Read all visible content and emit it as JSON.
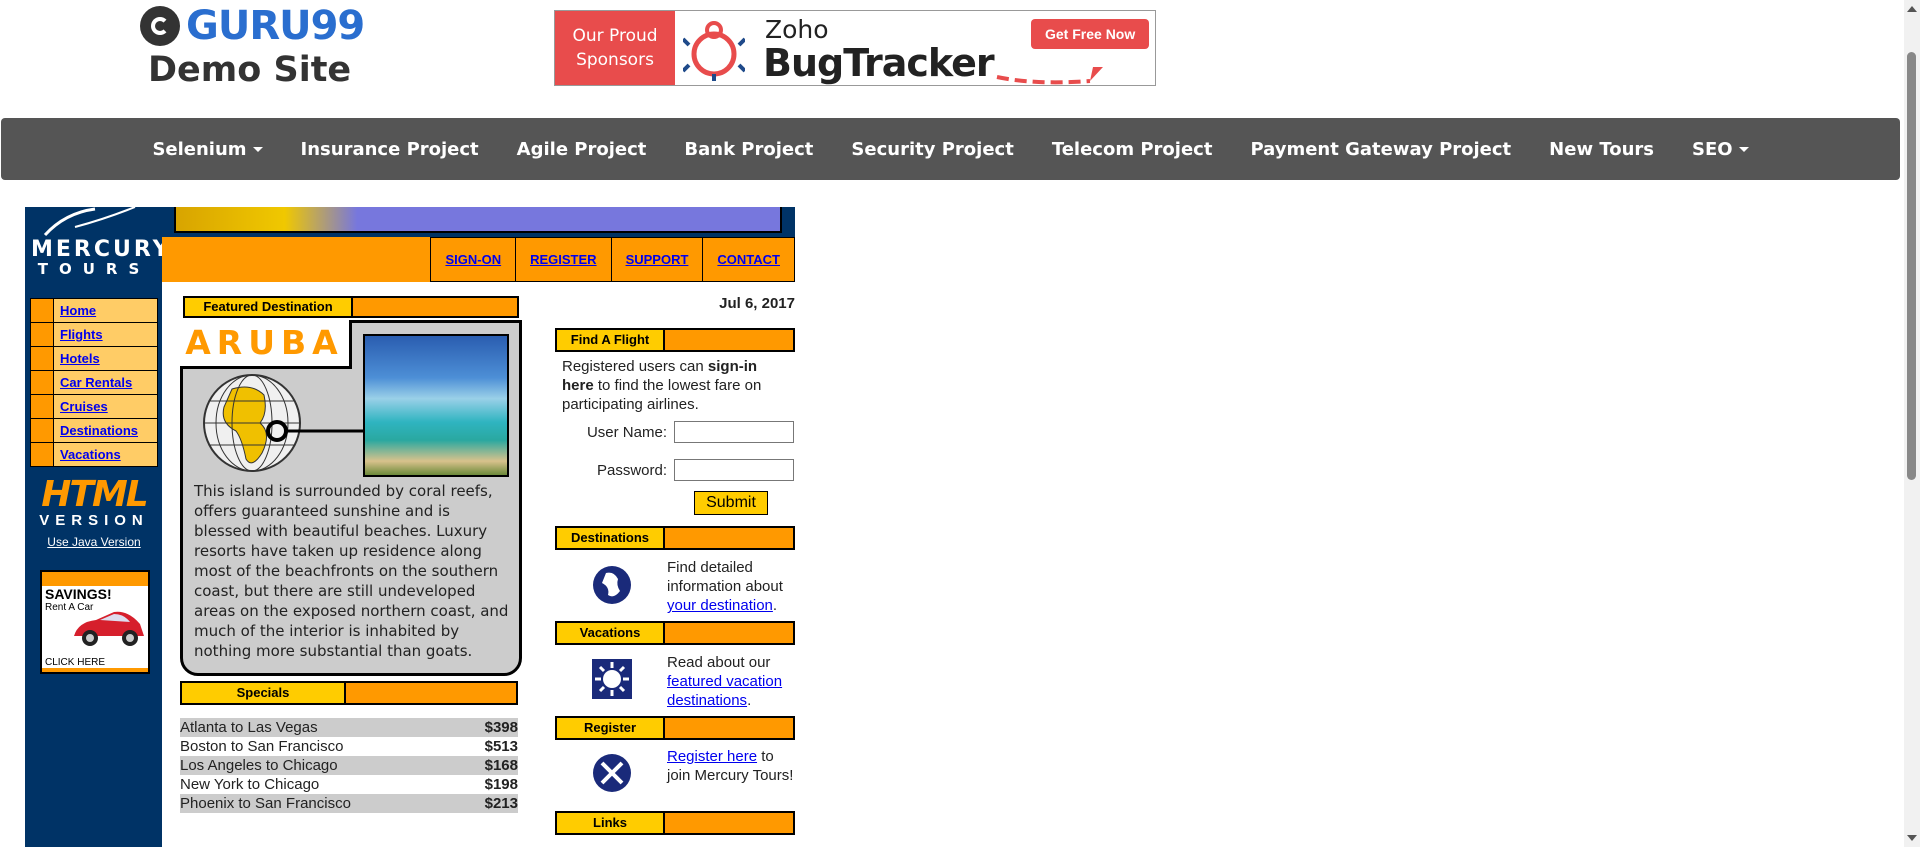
{
  "header": {
    "logo_brand": "GURU99",
    "logo_subtitle": "Demo Site",
    "sponsor_label_1": "Our Proud",
    "sponsor_label_2": "Sponsors",
    "sponsor_zoho": "Zoho",
    "sponsor_product": "BugTracker",
    "sponsor_cta": "Get Free Now"
  },
  "navbar": {
    "items": [
      {
        "label": "Selenium",
        "dropdown": true
      },
      {
        "label": "Insurance Project"
      },
      {
        "label": "Agile Project"
      },
      {
        "label": "Bank Project"
      },
      {
        "label": "Security Project"
      },
      {
        "label": "Telecom Project"
      },
      {
        "label": "Payment Gateway Project"
      },
      {
        "label": "New Tours"
      },
      {
        "label": "SEO",
        "dropdown": true
      }
    ]
  },
  "mercury": {
    "logo_line1": "MERCURY",
    "logo_line2": "TOURS",
    "top_links": [
      "SIGN-ON",
      "REGISTER",
      "SUPPORT",
      "CONTACT"
    ],
    "side_menu": [
      "Home",
      "Flights",
      "Hotels",
      "Car Rentals",
      "Cruises",
      "Destinations",
      "Vacations"
    ],
    "html_badge": "HTML",
    "html_version": "VERSION",
    "java_link": "Use Java Version",
    "savings_title": "SAVINGS!",
    "savings_sub": "Rent A Car",
    "savings_click": "CLICK HERE",
    "featured_label": "Featured Destination",
    "featured_name": "ARUBA",
    "featured_text": "This island is surrounded by coral reefs, offers guaranteed sunshine and is blessed with beautiful beaches. Luxury resorts have taken up residence along most of the beachfronts on the southern coast, but there are still undeveloped areas on the exposed northern coast, and much of the interior is inhabited by nothing more substantial than goats.",
    "specials_label": "Specials",
    "specials": [
      {
        "route": "Atlanta to Las Vegas",
        "price": "$398"
      },
      {
        "route": "Boston to San Francisco",
        "price": "$513"
      },
      {
        "route": "Los Angeles to Chicago",
        "price": "$168"
      },
      {
        "route": "New York to Chicago",
        "price": "$198"
      },
      {
        "route": "Phoenix to San Francisco",
        "price": "$213"
      }
    ],
    "date": "Jul 6, 2017",
    "find_flight_label": "Find A Flight",
    "find_flight_pre": "Registered users can ",
    "find_flight_bold": "sign-in here",
    "find_flight_post": " to find the lowest fare on participating airlines.",
    "username_label": "User Name:",
    "username_value": "",
    "password_label": "Password:",
    "password_value": "",
    "submit_label": "Submit",
    "destinations_label": "Destinations",
    "destinations_text": "Find detailed information about ",
    "destinations_link": "your destination",
    "vacations_label": "Vacations",
    "vacations_text": "Read about our ",
    "vacations_link": "featured vacation destinations",
    "register_label": "Register",
    "register_link": "Register here",
    "register_text": " to join Mercury Tours!",
    "links_label": "Links"
  },
  "colors": {
    "navbar": "#555555",
    "mercury_blue": "#003366",
    "orange": "#ff9900",
    "yellow": "#ffcc00",
    "light_orange": "#ffcc66"
  }
}
